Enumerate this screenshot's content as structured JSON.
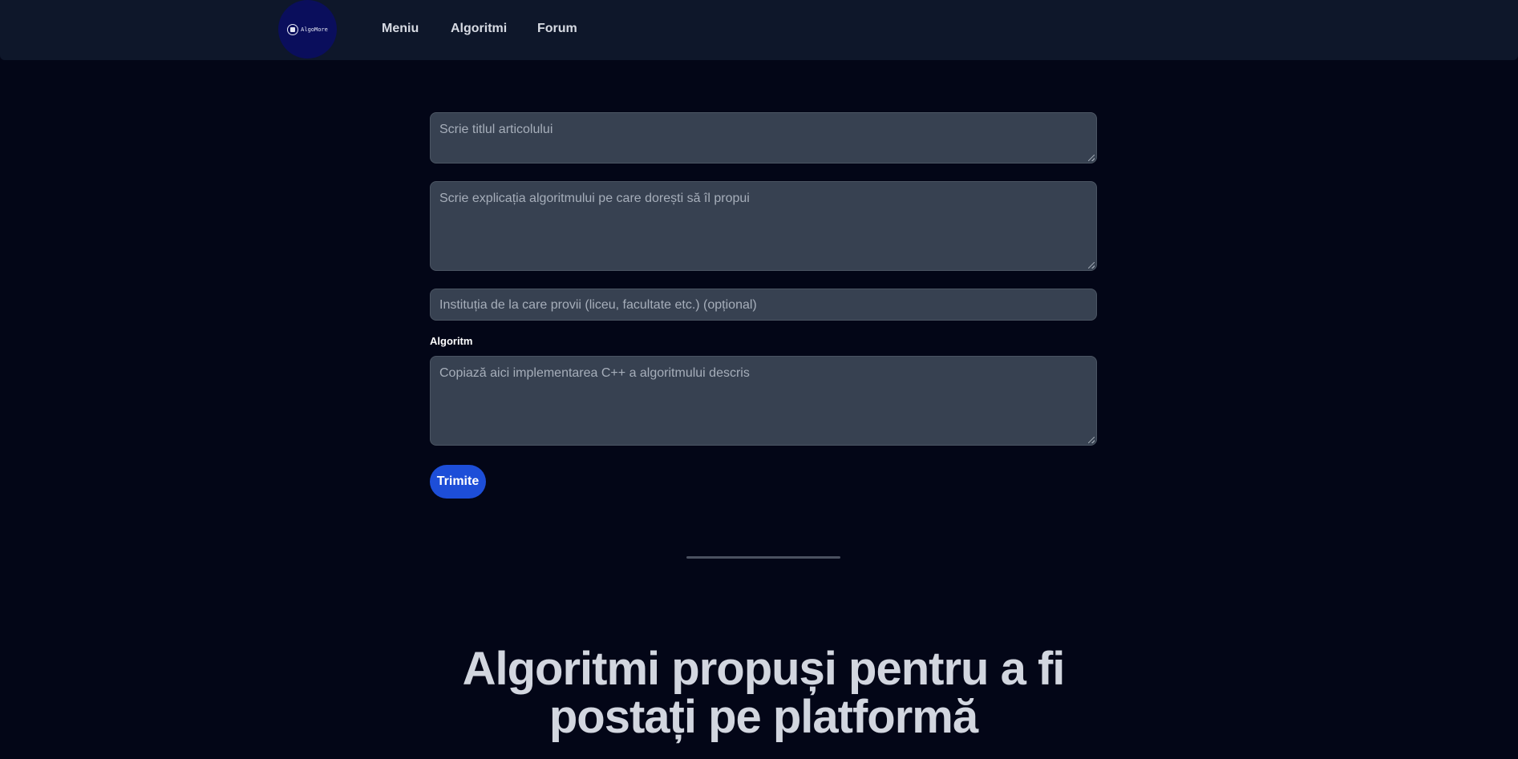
{
  "nav": {
    "logo_text": "AlgoMore",
    "links": [
      "Meniu",
      "Algoritmi",
      "Forum"
    ]
  },
  "form": {
    "title_placeholder": "Scrie titlul articolului",
    "explanation_placeholder": "Scrie explicația algoritmului pe care dorești să îl propui",
    "institution_placeholder": "Instituția de la care provii (liceu, facultate etc.) (opțional)",
    "algorithm_label": "Algoritm",
    "code_placeholder": "Copiază aici implementarea C++ a algoritmului descris",
    "submit_label": "Trimite"
  },
  "section": {
    "heading": "Algoritmi propuși pentru a fi postați pe platformă"
  },
  "colors": {
    "background": "#030617",
    "navbar": "#0e172a",
    "field": "#374151",
    "accent": "#1d4ed8"
  }
}
